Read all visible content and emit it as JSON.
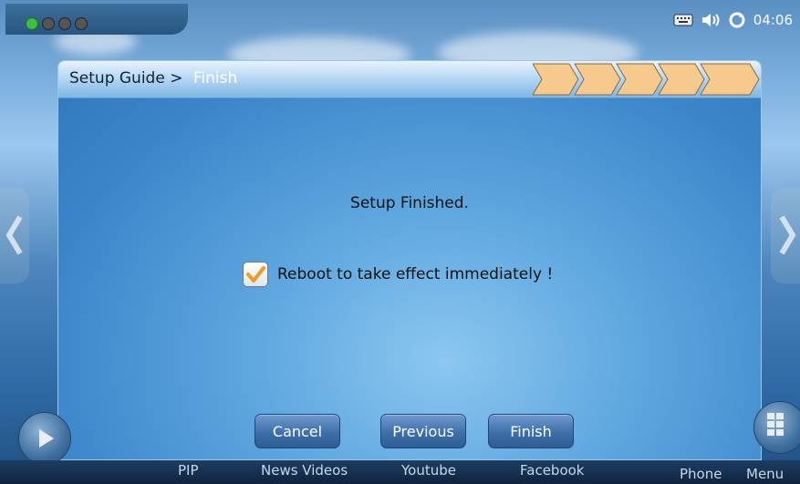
{
  "statusbar": {
    "time": "04:06",
    "indicator_dots": [
      "#3fbf3f",
      "#5a5a5a",
      "#5a5a5a",
      "#5a5a5a"
    ],
    "icons": [
      "keyboard-icon",
      "volume-icon",
      "sync-icon"
    ]
  },
  "dialog": {
    "breadcrumb_root": "Setup Guide",
    "breadcrumb_separator": ">",
    "breadcrumb_current": "Finish",
    "step_count": 5,
    "message": "Setup Finished.",
    "checkbox_label": "Reboot to take effect immediately !",
    "checkbox_checked": true,
    "buttons": {
      "cancel": "Cancel",
      "previous": "Previous",
      "finish": "Finish"
    }
  },
  "dock": {
    "items": [
      "PIP",
      "News Videos",
      "Youtube",
      "Facebook",
      "Phone",
      "Menu"
    ]
  },
  "colors": {
    "step_fill": "#f6c98d",
    "checkmark": "#f29a1d"
  }
}
